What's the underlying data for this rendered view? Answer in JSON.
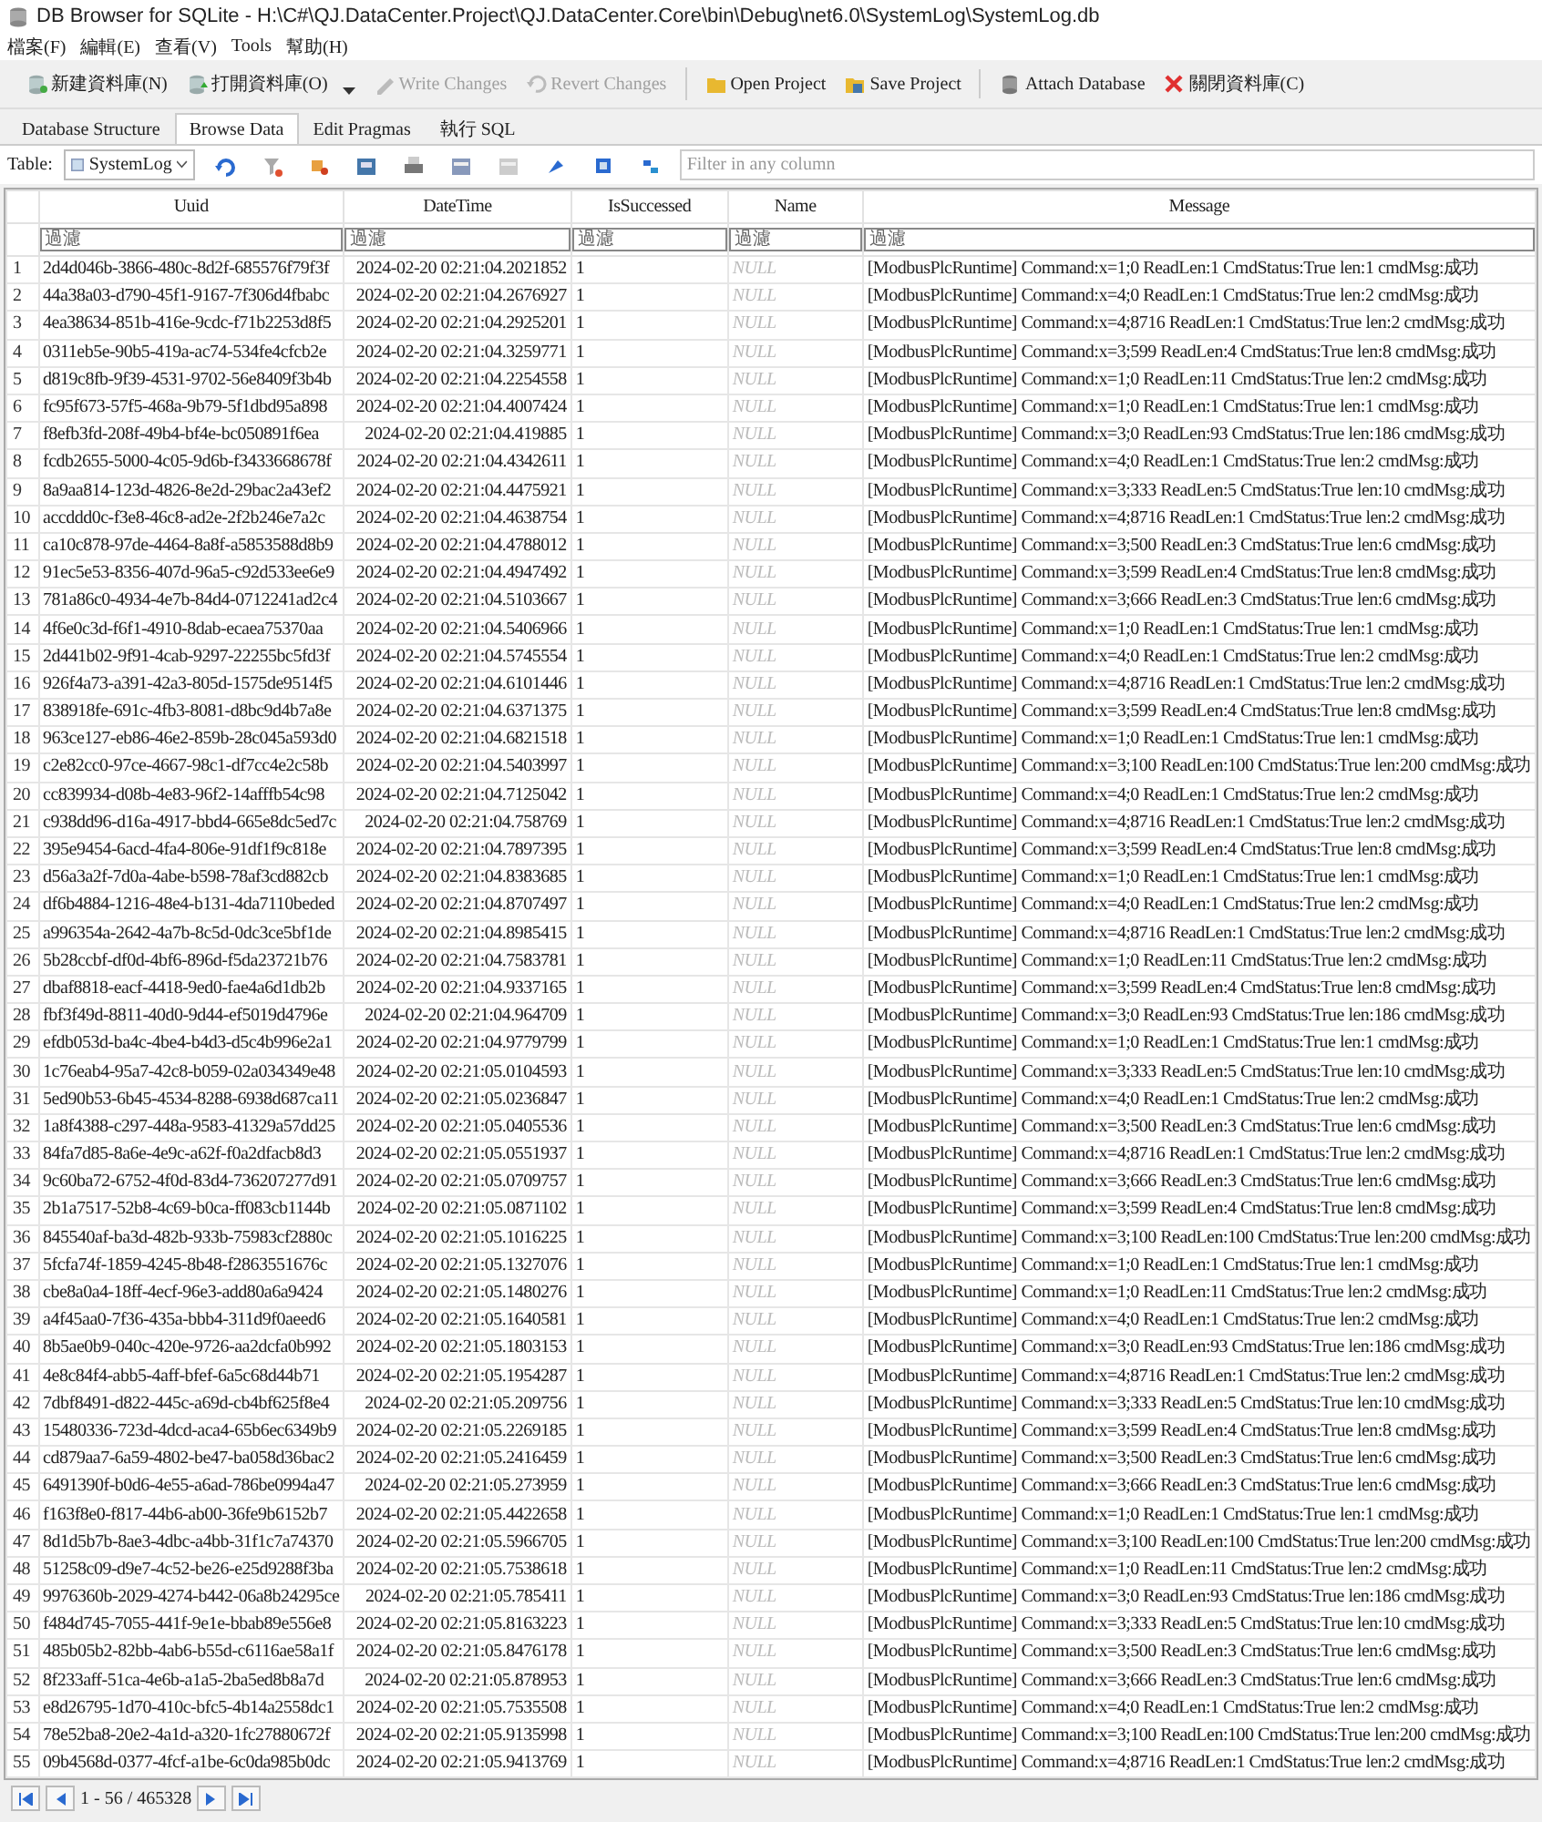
{
  "window": {
    "title": "DB Browser for SQLite - H:\\C#\\QJ.DataCenter.Project\\QJ.DataCenter.Core\\bin\\Debug\\net6.0\\SystemLog\\SystemLog.db"
  },
  "menu": [
    "檔案(F)",
    "編輯(E)",
    "查看(V)",
    "Tools",
    "幫助(H)"
  ],
  "toolbar": [
    {
      "buttons": [
        {
          "kind": "new-db",
          "label": "新建資料庫(N)",
          "disabled": false,
          "dropdown": false
        },
        {
          "kind": "open-db",
          "label": "打開資料庫(O)",
          "disabled": false,
          "dropdown": true
        },
        {
          "kind": "write",
          "label": "Write Changes",
          "disabled": true,
          "dropdown": false
        },
        {
          "kind": "revert",
          "label": "Revert Changes",
          "disabled": true,
          "dropdown": false
        }
      ]
    },
    {
      "buttons": [
        {
          "kind": "open-project",
          "label": "Open Project",
          "disabled": false,
          "dropdown": false
        },
        {
          "kind": "save-project",
          "label": "Save Project",
          "disabled": false,
          "dropdown": false
        }
      ]
    },
    {
      "buttons": [
        {
          "kind": "attach",
          "label": "Attach Database",
          "disabled": false,
          "dropdown": false
        },
        {
          "kind": "close-db",
          "label": "關閉資料庫(C)",
          "disabled": false,
          "dropdown": false
        }
      ]
    }
  ],
  "tabs": [
    {
      "label": "Database Structure",
      "selected": false
    },
    {
      "label": "Browse Data",
      "selected": true
    },
    {
      "label": "Edit Pragmas",
      "selected": false
    },
    {
      "label": "執行 SQL",
      "selected": false
    }
  ],
  "browse": {
    "table_label": "Table:",
    "table": "SystemLog",
    "filter_placeholder": "Filter in any column"
  },
  "columns": [
    "Uuid",
    "DateTime",
    "IsSuccessed",
    "Name",
    "Message"
  ],
  "filters": [
    {
      "placeholder": "過濾"
    },
    {
      "placeholder": "過濾"
    },
    {
      "placeholder": "過濾"
    },
    {
      "placeholder": "過濾"
    },
    {
      "placeholder": "過濾"
    }
  ],
  "rows": [
    {
      "number": "1",
      "cells": [
        "2d4d046b-3866-480c-8d2f-685576f79f3f",
        "2024-02-20 02:21:04.2021852",
        "1",
        "NULL",
        "[ModbusPlcRuntime] Command:x=1;0 ReadLen:1 CmdStatus:True len:1 cmdMsg:成功"
      ]
    },
    {
      "number": "2",
      "cells": [
        "44a38a03-d790-45f1-9167-7f306d4fbabc",
        "2024-02-20 02:21:04.2676927",
        "1",
        "NULL",
        "[ModbusPlcRuntime] Command:x=4;0 ReadLen:1 CmdStatus:True len:2 cmdMsg:成功"
      ]
    },
    {
      "number": "3",
      "cells": [
        "4ea38634-851b-416e-9cdc-f71b2253d8f5",
        "2024-02-20 02:21:04.2925201",
        "1",
        "NULL",
        "[ModbusPlcRuntime] Command:x=4;8716 ReadLen:1 CmdStatus:True len:2 cmdMsg:成功"
      ]
    },
    {
      "number": "4",
      "cells": [
        "0311eb5e-90b5-419a-ac74-534fe4cfcb2e",
        "2024-02-20 02:21:04.3259771",
        "1",
        "NULL",
        "[ModbusPlcRuntime] Command:x=3;599 ReadLen:4 CmdStatus:True len:8 cmdMsg:成功"
      ]
    },
    {
      "number": "5",
      "cells": [
        "d819c8fb-9f39-4531-9702-56e8409f3b4b",
        "2024-02-20 02:21:04.2254558",
        "1",
        "NULL",
        "[ModbusPlcRuntime] Command:x=1;0 ReadLen:11 CmdStatus:True len:2 cmdMsg:成功"
      ]
    },
    {
      "number": "6",
      "cells": [
        "fc95f673-57f5-468a-9b79-5f1dbd95a898",
        "2024-02-20 02:21:04.4007424",
        "1",
        "NULL",
        "[ModbusPlcRuntime] Command:x=1;0 ReadLen:1 CmdStatus:True len:1 cmdMsg:成功"
      ]
    },
    {
      "number": "7",
      "cells": [
        "f8efb3fd-208f-49b4-bf4e-bc050891f6ea",
        "2024-02-20 02:21:04.419885",
        "1",
        "NULL",
        "[ModbusPlcRuntime] Command:x=3;0 ReadLen:93 CmdStatus:True len:186 cmdMsg:成功"
      ]
    },
    {
      "number": "8",
      "cells": [
        "fcdb2655-5000-4c05-9d6b-f3433668678f",
        "2024-02-20 02:21:04.4342611",
        "1",
        "NULL",
        "[ModbusPlcRuntime] Command:x=4;0 ReadLen:1 CmdStatus:True len:2 cmdMsg:成功"
      ]
    },
    {
      "number": "9",
      "cells": [
        "8a9aa814-123d-4826-8e2d-29bac2a43ef2",
        "2024-02-20 02:21:04.4475921",
        "1",
        "NULL",
        "[ModbusPlcRuntime] Command:x=3;333 ReadLen:5 CmdStatus:True len:10 cmdMsg:成功"
      ]
    },
    {
      "number": "10",
      "cells": [
        "accddd0c-f3e8-46c8-ad2e-2f2b246e7a2c",
        "2024-02-20 02:21:04.4638754",
        "1",
        "NULL",
        "[ModbusPlcRuntime] Command:x=4;8716 ReadLen:1 CmdStatus:True len:2 cmdMsg:成功"
      ]
    },
    {
      "number": "11",
      "cells": [
        "ca10c878-97de-4464-8a8f-a5853588d8b9",
        "2024-02-20 02:21:04.4788012",
        "1",
        "NULL",
        "[ModbusPlcRuntime] Command:x=3;500 ReadLen:3 CmdStatus:True len:6 cmdMsg:成功"
      ]
    },
    {
      "number": "12",
      "cells": [
        "91ec5e53-8356-407d-96a5-c92d533ee6e9",
        "2024-02-20 02:21:04.4947492",
        "1",
        "NULL",
        "[ModbusPlcRuntime] Command:x=3;599 ReadLen:4 CmdStatus:True len:8 cmdMsg:成功"
      ]
    },
    {
      "number": "13",
      "cells": [
        "781a86c0-4934-4e7b-84d4-0712241ad2c4",
        "2024-02-20 02:21:04.5103667",
        "1",
        "NULL",
        "[ModbusPlcRuntime] Command:x=3;666 ReadLen:3 CmdStatus:True len:6 cmdMsg:成功"
      ]
    },
    {
      "number": "14",
      "cells": [
        "4f6e0c3d-f6f1-4910-8dab-ecaea75370aa",
        "2024-02-20 02:21:04.5406966",
        "1",
        "NULL",
        "[ModbusPlcRuntime] Command:x=1;0 ReadLen:1 CmdStatus:True len:1 cmdMsg:成功"
      ]
    },
    {
      "number": "15",
      "cells": [
        "2d441b02-9f91-4cab-9297-22255bc5fd3f",
        "2024-02-20 02:21:04.5745554",
        "1",
        "NULL",
        "[ModbusPlcRuntime] Command:x=4;0 ReadLen:1 CmdStatus:True len:2 cmdMsg:成功"
      ]
    },
    {
      "number": "16",
      "cells": [
        "926f4a73-a391-42a3-805d-1575de9514f5",
        "2024-02-20 02:21:04.6101446",
        "1",
        "NULL",
        "[ModbusPlcRuntime] Command:x=4;8716 ReadLen:1 CmdStatus:True len:2 cmdMsg:成功"
      ]
    },
    {
      "number": "17",
      "cells": [
        "838918fe-691c-4fb3-8081-d8bc9d4b7a8e",
        "2024-02-20 02:21:04.6371375",
        "1",
        "NULL",
        "[ModbusPlcRuntime] Command:x=3;599 ReadLen:4 CmdStatus:True len:8 cmdMsg:成功"
      ]
    },
    {
      "number": "18",
      "cells": [
        "963ce127-eb86-46e2-859b-28c045a593d0",
        "2024-02-20 02:21:04.6821518",
        "1",
        "NULL",
        "[ModbusPlcRuntime] Command:x=1;0 ReadLen:1 CmdStatus:True len:1 cmdMsg:成功"
      ]
    },
    {
      "number": "19",
      "cells": [
        "c2e82cc0-97ce-4667-98c1-df7cc4e2c58b",
        "2024-02-20 02:21:04.5403997",
        "1",
        "NULL",
        "[ModbusPlcRuntime] Command:x=3;100 ReadLen:100 CmdStatus:True len:200 cmdMsg:成功"
      ]
    },
    {
      "number": "20",
      "cells": [
        "cc839934-d08b-4e83-96f2-14afffb54c98",
        "2024-02-20 02:21:04.7125042",
        "1",
        "NULL",
        "[ModbusPlcRuntime] Command:x=4;0 ReadLen:1 CmdStatus:True len:2 cmdMsg:成功"
      ]
    },
    {
      "number": "21",
      "cells": [
        "c938dd96-d16a-4917-bbd4-665e8dc5ed7c",
        "2024-02-20 02:21:04.758769",
        "1",
        "NULL",
        "[ModbusPlcRuntime] Command:x=4;8716 ReadLen:1 CmdStatus:True len:2 cmdMsg:成功"
      ]
    },
    {
      "number": "22",
      "cells": [
        "395e9454-6acd-4fa4-806e-91df1f9c818e",
        "2024-02-20 02:21:04.7897395",
        "1",
        "NULL",
        "[ModbusPlcRuntime] Command:x=3;599 ReadLen:4 CmdStatus:True len:8 cmdMsg:成功"
      ]
    },
    {
      "number": "23",
      "cells": [
        "d56a3a2f-7d0a-4abe-b598-78af3cd882cb",
        "2024-02-20 02:21:04.8383685",
        "1",
        "NULL",
        "[ModbusPlcRuntime] Command:x=1;0 ReadLen:1 CmdStatus:True len:1 cmdMsg:成功"
      ]
    },
    {
      "number": "24",
      "cells": [
        "df6b4884-1216-48e4-b131-4da7110beded",
        "2024-02-20 02:21:04.8707497",
        "1",
        "NULL",
        "[ModbusPlcRuntime] Command:x=4;0 ReadLen:1 CmdStatus:True len:2 cmdMsg:成功"
      ]
    },
    {
      "number": "25",
      "cells": [
        "a996354a-2642-4a7b-8c5d-0dc3ce5bf1de",
        "2024-02-20 02:21:04.8985415",
        "1",
        "NULL",
        "[ModbusPlcRuntime] Command:x=4;8716 ReadLen:1 CmdStatus:True len:2 cmdMsg:成功"
      ]
    },
    {
      "number": "26",
      "cells": [
        "5b28ccbf-df0d-4bf6-896d-f5da23721b76",
        "2024-02-20 02:21:04.7583781",
        "1",
        "NULL",
        "[ModbusPlcRuntime] Command:x=1;0 ReadLen:11 CmdStatus:True len:2 cmdMsg:成功"
      ]
    },
    {
      "number": "27",
      "cells": [
        "dbaf8818-eacf-4418-9ed0-fae4a6d1db2b",
        "2024-02-20 02:21:04.9337165",
        "1",
        "NULL",
        "[ModbusPlcRuntime] Command:x=3;599 ReadLen:4 CmdStatus:True len:8 cmdMsg:成功"
      ]
    },
    {
      "number": "28",
      "cells": [
        "fbf3f49d-8811-40d0-9d44-ef5019d4796e",
        "2024-02-20 02:21:04.964709",
        "1",
        "NULL",
        "[ModbusPlcRuntime] Command:x=3;0 ReadLen:93 CmdStatus:True len:186 cmdMsg:成功"
      ]
    },
    {
      "number": "29",
      "cells": [
        "efdb053d-ba4c-4be4-b4d3-d5c4b996e2a1",
        "2024-02-20 02:21:04.9779799",
        "1",
        "NULL",
        "[ModbusPlcRuntime] Command:x=1;0 ReadLen:1 CmdStatus:True len:1 cmdMsg:成功"
      ]
    },
    {
      "number": "30",
      "cells": [
        "1c76eab4-95a7-42c8-b059-02a034349e48",
        "2024-02-20 02:21:05.0104593",
        "1",
        "NULL",
        "[ModbusPlcRuntime] Command:x=3;333 ReadLen:5 CmdStatus:True len:10 cmdMsg:成功"
      ]
    },
    {
      "number": "31",
      "cells": [
        "5ed90b53-6b45-4534-8288-6938d687ca11",
        "2024-02-20 02:21:05.0236847",
        "1",
        "NULL",
        "[ModbusPlcRuntime] Command:x=4;0 ReadLen:1 CmdStatus:True len:2 cmdMsg:成功"
      ]
    },
    {
      "number": "32",
      "cells": [
        "1a8f4388-c297-448a-9583-41329a57dd25",
        "2024-02-20 02:21:05.0405536",
        "1",
        "NULL",
        "[ModbusPlcRuntime] Command:x=3;500 ReadLen:3 CmdStatus:True len:6 cmdMsg:成功"
      ]
    },
    {
      "number": "33",
      "cells": [
        "84fa7d85-8a6e-4e9c-a62f-f0a2dfacb8d3",
        "2024-02-20 02:21:05.0551937",
        "1",
        "NULL",
        "[ModbusPlcRuntime] Command:x=4;8716 ReadLen:1 CmdStatus:True len:2 cmdMsg:成功"
      ]
    },
    {
      "number": "34",
      "cells": [
        "9c60ba72-6752-4f0d-83d4-736207277d91",
        "2024-02-20 02:21:05.0709757",
        "1",
        "NULL",
        "[ModbusPlcRuntime] Command:x=3;666 ReadLen:3 CmdStatus:True len:6 cmdMsg:成功"
      ]
    },
    {
      "number": "35",
      "cells": [
        "2b1a7517-52b8-4c69-b0ca-ff083cb1144b",
        "2024-02-20 02:21:05.0871102",
        "1",
        "NULL",
        "[ModbusPlcRuntime] Command:x=3;599 ReadLen:4 CmdStatus:True len:8 cmdMsg:成功"
      ]
    },
    {
      "number": "36",
      "cells": [
        "845540af-ba3d-482b-933b-75983cf2880c",
        "2024-02-20 02:21:05.1016225",
        "1",
        "NULL",
        "[ModbusPlcRuntime] Command:x=3;100 ReadLen:100 CmdStatus:True len:200 cmdMsg:成功"
      ]
    },
    {
      "number": "37",
      "cells": [
        "5fcfa74f-1859-4245-8b48-f2863551676c",
        "2024-02-20 02:21:05.1327076",
        "1",
        "NULL",
        "[ModbusPlcRuntime] Command:x=1;0 ReadLen:1 CmdStatus:True len:1 cmdMsg:成功"
      ]
    },
    {
      "number": "38",
      "cells": [
        "cbe8a0a4-18ff-4ecf-96e3-add80a6a9424",
        "2024-02-20 02:21:05.1480276",
        "1",
        "NULL",
        "[ModbusPlcRuntime] Command:x=1;0 ReadLen:11 CmdStatus:True len:2 cmdMsg:成功"
      ]
    },
    {
      "number": "39",
      "cells": [
        "a4f45aa0-7f36-435a-bbb4-311d9f0aeed6",
        "2024-02-20 02:21:05.1640581",
        "1",
        "NULL",
        "[ModbusPlcRuntime] Command:x=4;0 ReadLen:1 CmdStatus:True len:2 cmdMsg:成功"
      ]
    },
    {
      "number": "40",
      "cells": [
        "8b5ae0b9-040c-420e-9726-aa2dcfa0b992",
        "2024-02-20 02:21:05.1803153",
        "1",
        "NULL",
        "[ModbusPlcRuntime] Command:x=3;0 ReadLen:93 CmdStatus:True len:186 cmdMsg:成功"
      ]
    },
    {
      "number": "41",
      "cells": [
        "4e8c84f4-abb5-4aff-bfef-6a5c68d44b71",
        "2024-02-20 02:21:05.1954287",
        "1",
        "NULL",
        "[ModbusPlcRuntime] Command:x=4;8716 ReadLen:1 CmdStatus:True len:2 cmdMsg:成功"
      ]
    },
    {
      "number": "42",
      "cells": [
        "7dbf8491-d822-445c-a69d-cb4bf625f8e4",
        "2024-02-20 02:21:05.209756",
        "1",
        "NULL",
        "[ModbusPlcRuntime] Command:x=3;333 ReadLen:5 CmdStatus:True len:10 cmdMsg:成功"
      ]
    },
    {
      "number": "43",
      "cells": [
        "15480336-723d-4dcd-aca4-65b6ec6349b9",
        "2024-02-20 02:21:05.2269185",
        "1",
        "NULL",
        "[ModbusPlcRuntime] Command:x=3;599 ReadLen:4 CmdStatus:True len:8 cmdMsg:成功"
      ]
    },
    {
      "number": "44",
      "cells": [
        "cd879aa7-6a59-4802-be47-ba058d36bac2",
        "2024-02-20 02:21:05.2416459",
        "1",
        "NULL",
        "[ModbusPlcRuntime] Command:x=3;500 ReadLen:3 CmdStatus:True len:6 cmdMsg:成功"
      ]
    },
    {
      "number": "45",
      "cells": [
        "6491390f-b0d6-4e55-a6ad-786be0994a47",
        "2024-02-20 02:21:05.273959",
        "1",
        "NULL",
        "[ModbusPlcRuntime] Command:x=3;666 ReadLen:3 CmdStatus:True len:6 cmdMsg:成功"
      ]
    },
    {
      "number": "46",
      "cells": [
        "f163f8e0-f817-44b6-ab00-36fe9b6152b7",
        "2024-02-20 02:21:05.4422658",
        "1",
        "NULL",
        "[ModbusPlcRuntime] Command:x=1;0 ReadLen:1 CmdStatus:True len:1 cmdMsg:成功"
      ]
    },
    {
      "number": "47",
      "cells": [
        "8d1d5b7b-8ae3-4dbc-a4bb-31f1c7a74370",
        "2024-02-20 02:21:05.5966705",
        "1",
        "NULL",
        "[ModbusPlcRuntime] Command:x=3;100 ReadLen:100 CmdStatus:True len:200 cmdMsg:成功"
      ]
    },
    {
      "number": "48",
      "cells": [
        "51258c09-d9e7-4c52-be26-e25d9288f3ba",
        "2024-02-20 02:21:05.7538618",
        "1",
        "NULL",
        "[ModbusPlcRuntime] Command:x=1;0 ReadLen:11 CmdStatus:True len:2 cmdMsg:成功"
      ]
    },
    {
      "number": "49",
      "cells": [
        "9976360b-2029-4274-b442-06a8b24295ce",
        "2024-02-20 02:21:05.785411",
        "1",
        "NULL",
        "[ModbusPlcRuntime] Command:x=3;0 ReadLen:93 CmdStatus:True len:186 cmdMsg:成功"
      ]
    },
    {
      "number": "50",
      "cells": [
        "f484d745-7055-441f-9e1e-bbab89e556e8",
        "2024-02-20 02:21:05.8163223",
        "1",
        "NULL",
        "[ModbusPlcRuntime] Command:x=3;333 ReadLen:5 CmdStatus:True len:10 cmdMsg:成功"
      ]
    },
    {
      "number": "51",
      "cells": [
        "485b05b2-82bb-4ab6-b55d-c6116ae58a1f",
        "2024-02-20 02:21:05.8476178",
        "1",
        "NULL",
        "[ModbusPlcRuntime] Command:x=3;500 ReadLen:3 CmdStatus:True len:6 cmdMsg:成功"
      ]
    },
    {
      "number": "52",
      "cells": [
        "8f233aff-51ca-4e6b-a1a5-2ba5ed8b8a7d",
        "2024-02-20 02:21:05.878953",
        "1",
        "NULL",
        "[ModbusPlcRuntime] Command:x=3;666 ReadLen:3 CmdStatus:True len:6 cmdMsg:成功"
      ]
    },
    {
      "number": "53",
      "cells": [
        "e8d26795-1d70-410c-bfc5-4b14a2558dc1",
        "2024-02-20 02:21:05.7535508",
        "1",
        "NULL",
        "[ModbusPlcRuntime] Command:x=4;0 ReadLen:1 CmdStatus:True len:2 cmdMsg:成功"
      ]
    },
    {
      "number": "54",
      "cells": [
        "78e52ba8-20e2-4a1d-a320-1fc27880672f",
        "2024-02-20 02:21:05.9135998",
        "1",
        "NULL",
        "[ModbusPlcRuntime] Command:x=3;100 ReadLen:100 CmdStatus:True len:200 cmdMsg:成功"
      ]
    },
    {
      "number": "55",
      "cells": [
        "09b4568d-0377-4fcf-a1be-6c0da985b0dc",
        "2024-02-20 02:21:05.9413769",
        "1",
        "NULL",
        "[ModbusPlcRuntime] Command:x=4;8716 ReadLen:1 CmdStatus:True len:2 cmdMsg:成功"
      ]
    }
  ],
  "pager": {
    "range": "1 - 56 / 465328"
  }
}
